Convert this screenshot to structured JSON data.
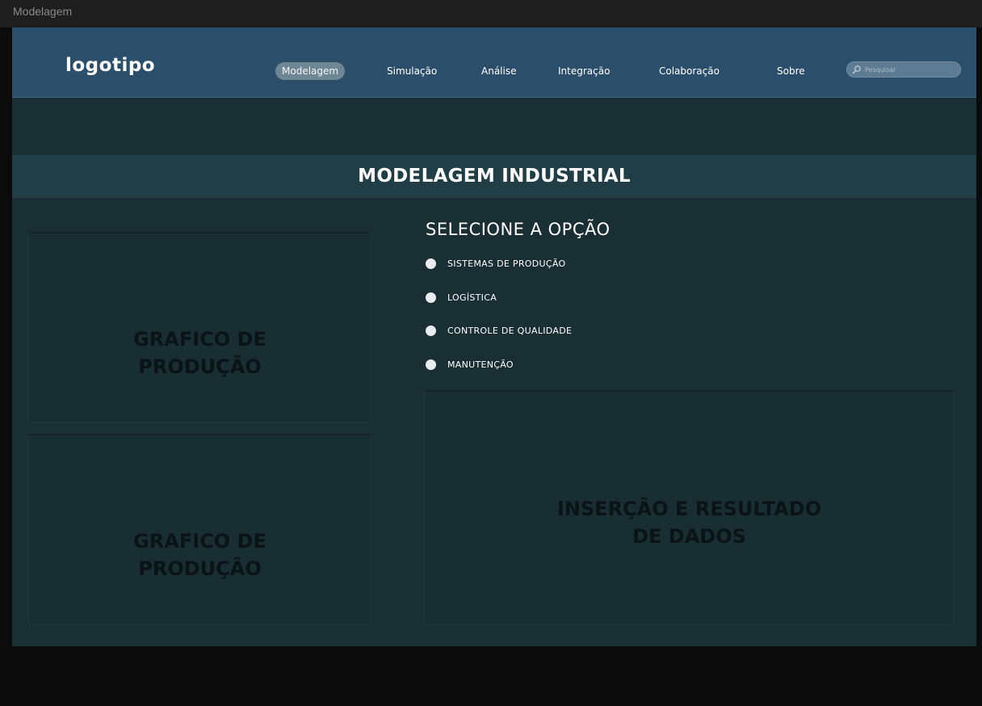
{
  "window": {
    "title": "Modelagem"
  },
  "header": {
    "logo": "logotipo",
    "nav": [
      {
        "label": "Modelagem",
        "active": true
      },
      {
        "label": "Simulação",
        "active": false
      },
      {
        "label": "Análise",
        "active": false
      },
      {
        "label": "Integração",
        "active": false
      },
      {
        "label": "Colaboração",
        "active": false
      },
      {
        "label": "Sobre",
        "active": false
      }
    ],
    "search": {
      "placeholder": "Pesquisar",
      "icon": "search-icon"
    }
  },
  "section": {
    "title": "MODELAGEM INDUSTRIAL"
  },
  "panels": {
    "chart_top": "GRAFICO DE PRODUÇÃO",
    "chart_bottom": "GRAFICO DE PRODUÇÃO",
    "data_panel": "INSERÇÃO E RESULTADO DE DADOS"
  },
  "options": {
    "title": "SELECIONE A OPÇÃO",
    "items": [
      {
        "label": "SISTEMAS DE PRODUÇÃO"
      },
      {
        "label": "LOGÍSTICA"
      },
      {
        "label": "CONTROLE DE QUALIDADE"
      },
      {
        "label": "MANUTENÇÃO"
      }
    ]
  },
  "colors": {
    "navbar": "#2b4e6b",
    "background": "#1a2f34",
    "section_header": "#213d46",
    "panel_text": "#0a1417",
    "active_nav": "#6f8695"
  }
}
